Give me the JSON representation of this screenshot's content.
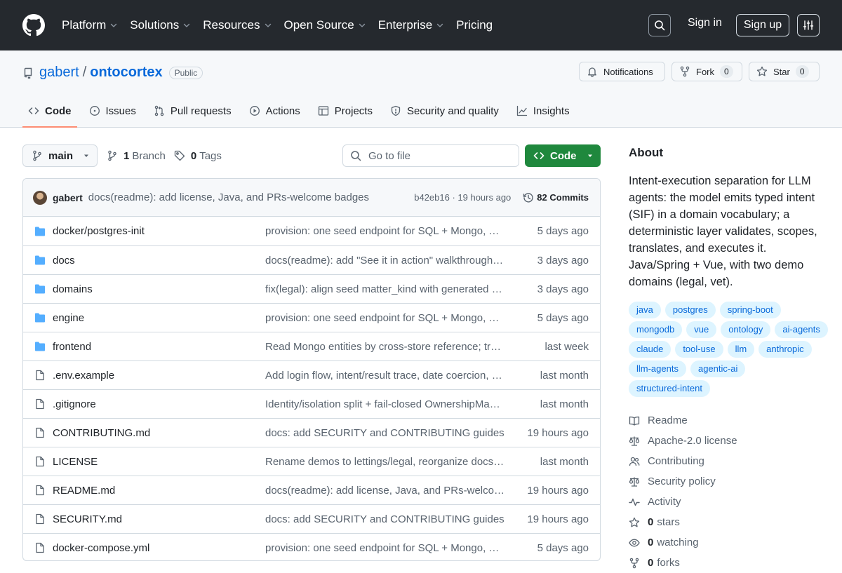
{
  "header": {
    "nav": [
      {
        "label": "Platform",
        "chevron": true
      },
      {
        "label": "Solutions",
        "chevron": true
      },
      {
        "label": "Resources",
        "chevron": true
      },
      {
        "label": "Open Source",
        "chevron": true
      },
      {
        "label": "Enterprise",
        "chevron": true
      },
      {
        "label": "Pricing",
        "chevron": false
      }
    ],
    "sign_in": "Sign in",
    "sign_up": "Sign up"
  },
  "repo": {
    "owner": "gabert",
    "separator": "/",
    "name": "ontocortex",
    "visibility": "Public",
    "notifications_label": "Notifications",
    "fork_label": "Fork",
    "fork_count": "0",
    "star_label": "Star",
    "star_count": "0"
  },
  "tabs": [
    {
      "label": "Code",
      "icon": "code-icon",
      "active": true
    },
    {
      "label": "Issues",
      "icon": "issue-icon",
      "active": false
    },
    {
      "label": "Pull requests",
      "icon": "pull-request-icon",
      "active": false
    },
    {
      "label": "Actions",
      "icon": "play-icon",
      "active": false
    },
    {
      "label": "Projects",
      "icon": "table-icon",
      "active": false
    },
    {
      "label": "Security and quality",
      "icon": "shield-icon",
      "active": false
    },
    {
      "label": "Insights",
      "icon": "graph-icon",
      "active": false
    }
  ],
  "toolbar": {
    "branch": "main",
    "branch_count": "1",
    "branch_label": "Branch",
    "tag_count": "0",
    "tag_label": "Tags",
    "goto_placeholder": "Go to file",
    "code_button": "Code"
  },
  "latest_commit": {
    "author": "gabert",
    "message": "docs(readme): add license, Java, and PRs-welcome badges",
    "hash_time": "b42eb16 · 19 hours ago",
    "commits_label": "82 Commits"
  },
  "files": [
    {
      "type": "dir",
      "name": "docker/postgres-init",
      "message": "provision: one seed endpoint for SQL + Mongo, auto-detected from schema",
      "date": "5 days ago"
    },
    {
      "type": "dir",
      "name": "docs",
      "message": "docs(readme): add \"See it in action\" walkthrough with screenshots",
      "date": "3 days ago"
    },
    {
      "type": "dir",
      "name": "domains",
      "message": "fix(legal): align seed matter_kind with generated domain values",
      "date": "3 days ago"
    },
    {
      "type": "dir",
      "name": "engine",
      "message": "provision: one seed endpoint for SQL + Mongo, auto-detected from schema",
      "date": "5 days ago"
    },
    {
      "type": "dir",
      "name": "frontend",
      "message": "Read Mongo entities by cross-store reference; trace panel updates",
      "date": "last week"
    },
    {
      "type": "file",
      "name": ".env.example",
      "message": "Add login flow, intent/result trace, date coercion, (and more)",
      "date": "last month"
    },
    {
      "type": "file",
      "name": ".gitignore",
      "message": "Identity/isolation split + fail-closed OwnershipMap enforcement",
      "date": "last month"
    },
    {
      "type": "file",
      "name": "CONTRIBUTING.md",
      "message": "docs: add SECURITY and CONTRIBUTING guides",
      "date": "19 hours ago"
    },
    {
      "type": "file",
      "name": "LICENSE",
      "message": "Rename demos to lettings/legal, reorganize docs, add license",
      "date": "last month"
    },
    {
      "type": "file",
      "name": "README.md",
      "message": "docs(readme): add license, Java, and PRs-welcome badges",
      "date": "19 hours ago"
    },
    {
      "type": "file",
      "name": "SECURITY.md",
      "message": "docs: add SECURITY and CONTRIBUTING guides",
      "date": "19 hours ago"
    },
    {
      "type": "file",
      "name": "docker-compose.yml",
      "message": "provision: one seed endpoint for SQL + Mongo, auto-detected from schema",
      "date": "5 days ago"
    }
  ],
  "about": {
    "title": "About",
    "description": "Intent-execution separation for LLM agents: the model emits typed intent (SIF) in a domain vocabulary; a deterministic layer validates, scopes, translates, and executes it. Java/Spring + Vue, with two demo domains (legal, vet).",
    "topics": [
      "java",
      "postgres",
      "spring-boot",
      "mongodb",
      "vue",
      "ontology",
      "ai-agents",
      "claude",
      "tool-use",
      "llm",
      "anthropic",
      "llm-agents",
      "agentic-ai",
      "structured-intent"
    ],
    "links": [
      {
        "icon": "book-icon",
        "count": "",
        "label": "Readme"
      },
      {
        "icon": "law-icon",
        "count": "",
        "label": "Apache-2.0 license"
      },
      {
        "icon": "people-icon",
        "count": "",
        "label": "Contributing"
      },
      {
        "icon": "law-icon",
        "count": "",
        "label": "Security policy"
      },
      {
        "icon": "pulse-icon",
        "count": "",
        "label": "Activity"
      },
      {
        "icon": "star-icon",
        "count": "0",
        "label": "stars"
      },
      {
        "icon": "eye-icon",
        "count": "0",
        "label": "watching"
      },
      {
        "icon": "fork-icon",
        "count": "0",
        "label": "forks"
      }
    ]
  },
  "colors": {
    "header_bg": "#25292e",
    "link": "#0969da",
    "code_button": "#1f883d",
    "folder": "#54aeff",
    "topic_bg": "#ddf4ff",
    "active_tab_underline": "#fd8c73"
  }
}
